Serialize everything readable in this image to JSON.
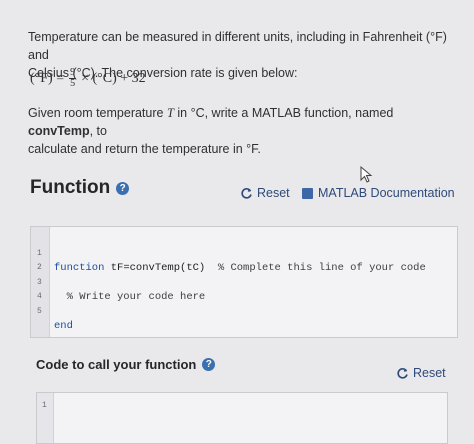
{
  "intro": {
    "line1": "Temperature can be measured in different units, including in Fahrenheit (°F) and",
    "line2": "Celsius (°C). The conversion rate is given below:",
    "formula_left": "(°F) =",
    "formula_num": "9",
    "formula_den": "5",
    "formula_right": "× (°C) + 32",
    "task_line1_a": "Given room temperature ",
    "task_T": "T",
    "task_line1_b": " in °C, write a MATLAB function, named ",
    "func_name": "convTemp",
    "task_line1_c": ", to",
    "task_line2": "calculate and return the temperature in °F."
  },
  "function_section": {
    "title": "Function",
    "reset_label": "Reset",
    "doc_label": "MATLAB Documentation"
  },
  "editor": {
    "lines": [
      {
        "num": "1",
        "kw": "function",
        "text": " tF=convTemp(tC)",
        "comment": "  % Complete this line of your code"
      },
      {
        "num": "2",
        "kw": "",
        "text": "",
        "comment": ""
      },
      {
        "num": "3",
        "kw": "",
        "text": "",
        "comment": "  % Write your code here"
      },
      {
        "num": "4",
        "kw": "",
        "text": "",
        "comment": ""
      },
      {
        "num": "5",
        "kw": "end",
        "text": "",
        "comment": ""
      }
    ]
  },
  "call_section": {
    "title": "Code to call your function",
    "reset_label": "Reset",
    "line_num": "1"
  },
  "colors": {
    "link": "#2d4a78",
    "keyword": "#1a4fa0",
    "help": "#3b6fb0"
  }
}
